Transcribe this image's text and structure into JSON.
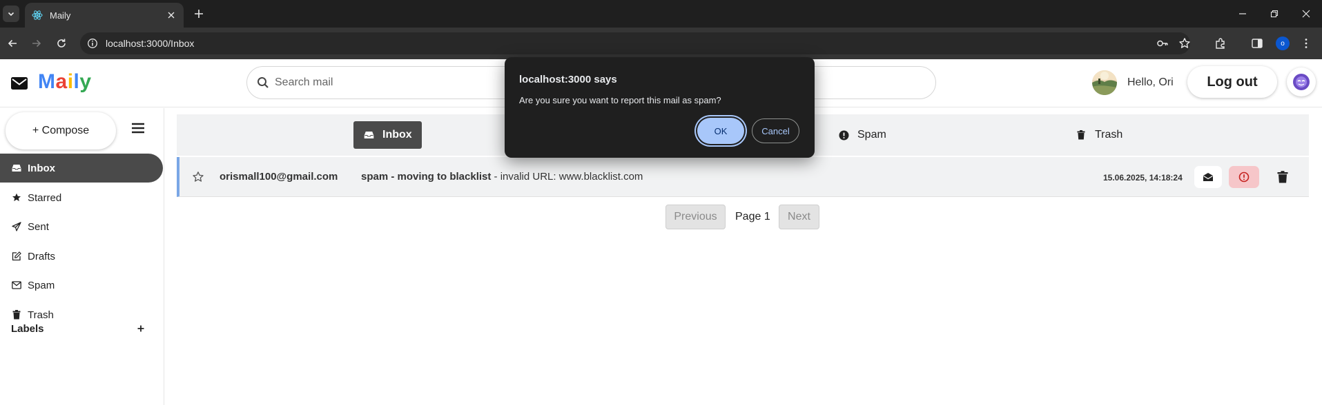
{
  "browser": {
    "tab_title": "Maily",
    "url": "localhost:3000/Inbox",
    "profile_initial": "o"
  },
  "app": {
    "logo_letters": [
      {
        "char": "M",
        "color": "#4285f4"
      },
      {
        "char": "a",
        "color": "#ea4335"
      },
      {
        "char": "i",
        "color": "#fbbc05"
      },
      {
        "char": "l",
        "color": "#4285f4"
      },
      {
        "char": "y",
        "color": "#34a853"
      }
    ],
    "search_placeholder": "Search mail",
    "greeting": "Hello, Ori",
    "logout_label": "Log out"
  },
  "sidebar": {
    "compose_label": "+ Compose",
    "items": [
      {
        "label": "Inbox",
        "icon": "inbox-icon",
        "active": true
      },
      {
        "label": "Starred",
        "icon": "star-icon",
        "active": false
      },
      {
        "label": "Sent",
        "icon": "paper-plane-icon",
        "active": false
      },
      {
        "label": "Drafts",
        "icon": "edit-icon",
        "active": false
      },
      {
        "label": "Spam",
        "icon": "envelope-icon",
        "active": false
      },
      {
        "label": "Trash",
        "icon": "trash-icon",
        "active": false
      }
    ],
    "labels_heading": "Labels",
    "labels_add": "+"
  },
  "folder_tabs": [
    {
      "label": "Inbox",
      "icon": "inbox-icon",
      "active": true
    },
    {
      "label": "Spam",
      "icon": "exclamation-circle-icon",
      "active": false
    },
    {
      "label": "Trash",
      "icon": "trash-icon",
      "active": false
    }
  ],
  "mail": {
    "sender": "orismall100@gmail.com",
    "subject": "spam - moving to blacklist",
    "snippet": " - invalid URL: www.blacklist.com",
    "date": "15.06.2025, 14:18:24",
    "starred": false,
    "accent_color": "#7aa7e6"
  },
  "pagination": {
    "previous_label": "Previous",
    "page_label": "Page 1",
    "next_label": "Next"
  },
  "dialog": {
    "title": "localhost:3000 says",
    "message": "Are you sure you want to report this mail as spam?",
    "ok_label": "OK",
    "cancel_label": "Cancel"
  },
  "colors": {
    "active_nav": "#4a4a4a",
    "dialog_bg": "#1f1f1f",
    "dialog_accent": "#a8c7fa",
    "spam_button_bg": "#f6c6c9",
    "spam_button_icon": "#c5221f"
  }
}
